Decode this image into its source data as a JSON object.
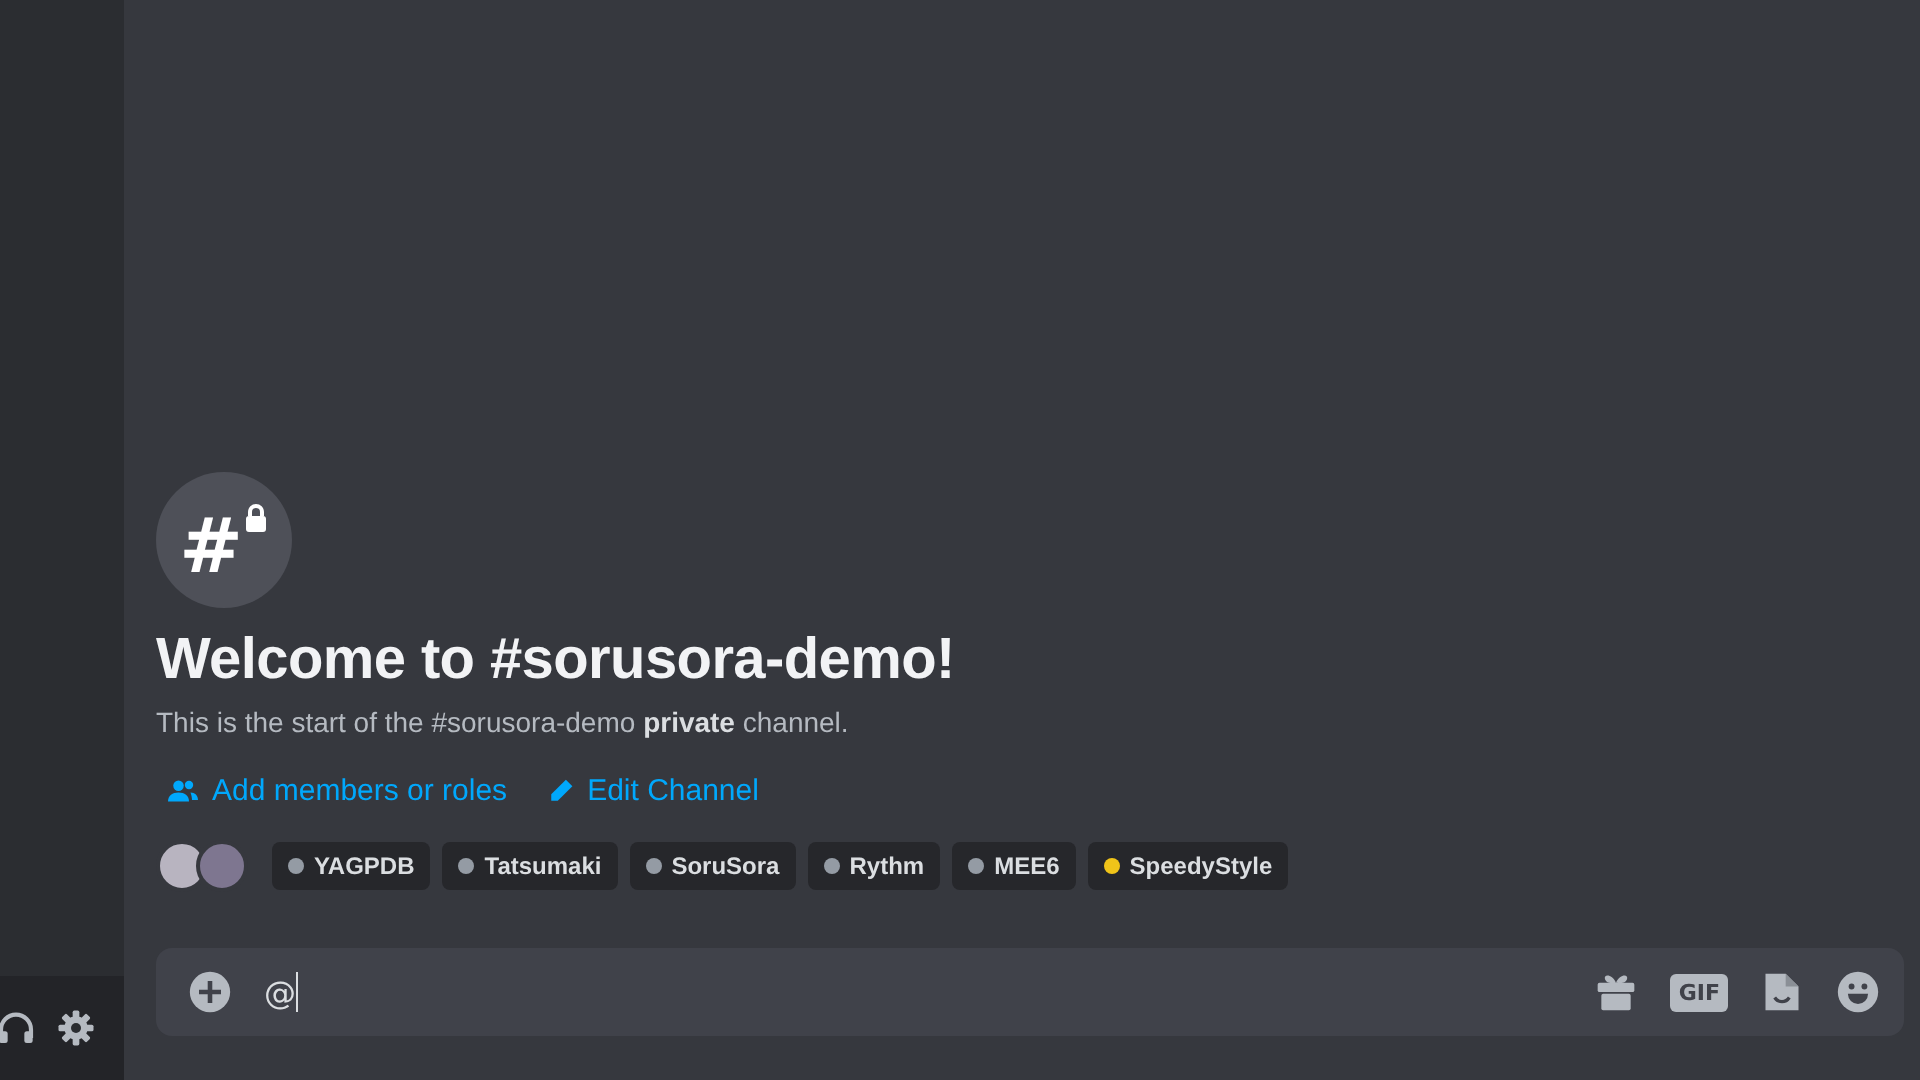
{
  "channel": {
    "icon_text": "#",
    "title": "Welcome to #sorusora-demo!",
    "description": "This is the start of the #sorusora-demo **private** channel."
  },
  "actions": [
    {
      "kind": "members",
      "label": "Add members or roles"
    },
    {
      "kind": "edit",
      "label": "Edit Channel"
    }
  ],
  "avatars": [
    {
      "kind": "photo"
    },
    {
      "kind": "photo"
    }
  ],
  "roles": [
    {
      "name": "YAGPDB",
      "color": "#949ba4"
    },
    {
      "name": "Tatsumaki",
      "color": "#949ba4"
    },
    {
      "name": "SoruSora",
      "color": "#949ba4"
    },
    {
      "name": "Rythm",
      "color": "#949ba4"
    },
    {
      "name": "MEE6",
      "color": "#949ba4"
    },
    {
      "name": "SpeedyStyle",
      "color": "#f0c419"
    }
  ],
  "composer": {
    "value": "@",
    "gif_label": "GIF"
  }
}
